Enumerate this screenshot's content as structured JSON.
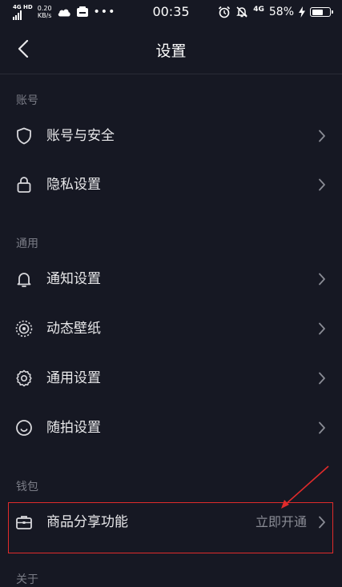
{
  "status_bar": {
    "network": "4G HD",
    "speed_value": "0.20",
    "speed_unit": "KB/s",
    "time": "00:35",
    "network2": "4G",
    "battery": "58%"
  },
  "header": {
    "title": "设置"
  },
  "sections": [
    {
      "label": "账号",
      "items": [
        {
          "label": "账号与安全",
          "icon": "shield-icon"
        },
        {
          "label": "隐私设置",
          "icon": "lock-icon"
        }
      ]
    },
    {
      "label": "通用",
      "items": [
        {
          "label": "通知设置",
          "icon": "bell-icon"
        },
        {
          "label": "动态壁纸",
          "icon": "wallpaper-icon"
        },
        {
          "label": "通用设置",
          "icon": "gear-icon"
        },
        {
          "label": "随拍设置",
          "icon": "camera-circle-icon"
        }
      ]
    },
    {
      "label": "钱包",
      "items": [
        {
          "label": "商品分享功能",
          "value": "立即开通",
          "icon": "briefcase-icon"
        }
      ]
    },
    {
      "label": "关于",
      "items": []
    }
  ],
  "colors": {
    "background": "#161823",
    "text": "#e8e8ea",
    "muted": "#7a7c86",
    "annotation": "#e02b2b"
  }
}
